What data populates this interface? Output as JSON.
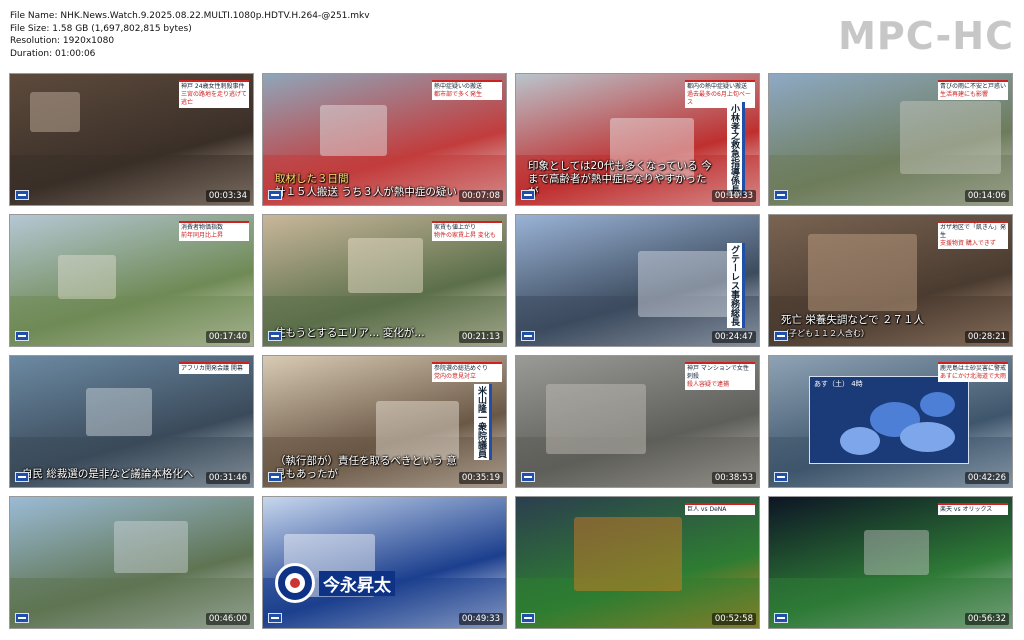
{
  "file_info": {
    "file_name": "File Name: NHK.News.Watch.9.2025.08.22.MULTI.1080p.HDTV.H.264-@251.mkv",
    "file_size": "File Size: 1.58 GB (1,697,802,815 bytes)",
    "resolution": "Resolution: 1920x1080",
    "duration": "Duration: 01:00:06"
  },
  "brand": "MPC-HC",
  "thumbnails": [
    {
      "time": "00:03:34",
      "caption": "",
      "topbox": [
        "神戸 24歳女性刺殺事件",
        "三宮の路地を走り逃げて逃亡"
      ],
      "vertical": "",
      "palette": [
        "#5d4a3c",
        "#3a2f28",
        "#c9b7a6"
      ]
    },
    {
      "time": "00:07:08",
      "caption": "計１５人搬送 うち３人が熱中症の疑い",
      "caption_hl": "取材した３日間",
      "topbox": [
        "熱中症疑いの搬送",
        "都市部で多く発生"
      ],
      "vertical": "",
      "palette": [
        "#8fa6ba",
        "#c23c3c",
        "#e8e8e8"
      ]
    },
    {
      "time": "00:10:33",
      "caption": "印象としては20代も多くなっている 今まで高齢者が熱中症になりやすかったが",
      "topbox": [
        "都内の熱中症疑い搬送",
        "過去最多の6月上旬ペース"
      ],
      "vertical": "小林孝之救急指導係長",
      "palette": [
        "#b9c4cc",
        "#bf2f2f",
        "#f0f0f0"
      ]
    },
    {
      "time": "00:14:06",
      "caption": "",
      "topbox": [
        "青びの雨に不安と戸惑い",
        "生活再建にも影響"
      ],
      "vertical": "",
      "palette": [
        "#8ea9c4",
        "#6d7c5b",
        "#c9c9c0"
      ]
    },
    {
      "time": "00:17:40",
      "caption": "",
      "topbox": [
        "消費者物価指数",
        "前年同月比上昇"
      ],
      "vertical": "",
      "palette": [
        "#b5c7d4",
        "#6f8a55",
        "#e3e0d2"
      ]
    },
    {
      "time": "00:21:13",
      "caption": "住もうとするエリア… 変化が…",
      "topbox": [
        "家賃も値上がり",
        "物件の家賃上昇 変化も"
      ],
      "vertical": "",
      "palette": [
        "#c9b79b",
        "#5b6f4a",
        "#f1e7d2"
      ]
    },
    {
      "time": "00:24:47",
      "caption": "",
      "topbox": [],
      "vertical": "グテーレス事務総長",
      "palette": [
        "#9ab3d6",
        "#3c4b5e",
        "#dde3ea"
      ]
    },
    {
      "time": "00:28:21",
      "caption": "死亡 栄養失調などで ２７１人",
      "caption_sub": "（子ども１１２人含む）",
      "topbox": [
        "ガザ地区で「飢きん」発生",
        "支援物資 購入できず"
      ],
      "vertical": "",
      "palette": [
        "#7a6452",
        "#4a3b30",
        "#c7a68a"
      ]
    },
    {
      "time": "00:31:46",
      "caption": "自民 総裁選の是非など議論本格化へ",
      "topbox": [
        "アフリカ開発会議 開幕",
        ""
      ],
      "vertical": "",
      "palette": [
        "#6c8aa3",
        "#3a4a5a",
        "#d5dde3"
      ]
    },
    {
      "time": "00:35:19",
      "caption": "（執行部が）責任を取るべきという 意見もあったが",
      "topbox": [
        "参院選の総括めぐり",
        "党内の意見対立"
      ],
      "vertical": "米山隆一衆院議員",
      "palette": [
        "#d8cbb4",
        "#6a5745",
        "#f2eadf"
      ]
    },
    {
      "time": "00:38:53",
      "caption": "",
      "topbox": [
        "神戸 マンションで女性刺殺",
        "殺人容疑で逮捕"
      ],
      "vertical": "",
      "palette": [
        "#9a9a96",
        "#5e5e5a",
        "#c9c6bd"
      ]
    },
    {
      "time": "00:42:26",
      "caption": "",
      "topbox": [
        "鹿児島は土砂災害に警戒",
        "あすにかけ北海道で大雨"
      ],
      "vertical": "",
      "weather_header": "あす（土） 4時",
      "palette": [
        "#8fa3b5",
        "#3e556b",
        "#d6e0ea"
      ]
    },
    {
      "time": "00:46:00",
      "caption": "",
      "topbox": [],
      "vertical": "",
      "palette": [
        "#9bbbd6",
        "#5e7452",
        "#d0d7db"
      ]
    },
    {
      "time": "00:49:33",
      "caption": "",
      "topbox": [],
      "vertical": "",
      "name_badge": "今永昇太",
      "palette": [
        "#c7d7ee",
        "#1c3f8e",
        "#ffffff"
      ]
    },
    {
      "time": "00:52:58",
      "caption": "",
      "topbox": [
        "巨人 vs DeNA",
        ""
      ],
      "vertical": "",
      "palette": [
        "#2c3e4e",
        "#2e7d32",
        "#e67e22"
      ]
    },
    {
      "time": "00:56:32",
      "caption": "",
      "topbox": [
        "楽天 vs オリックス",
        ""
      ],
      "vertical": "",
      "palette": [
        "#0d1525",
        "#2e7a36",
        "#c9c9c9"
      ]
    }
  ]
}
